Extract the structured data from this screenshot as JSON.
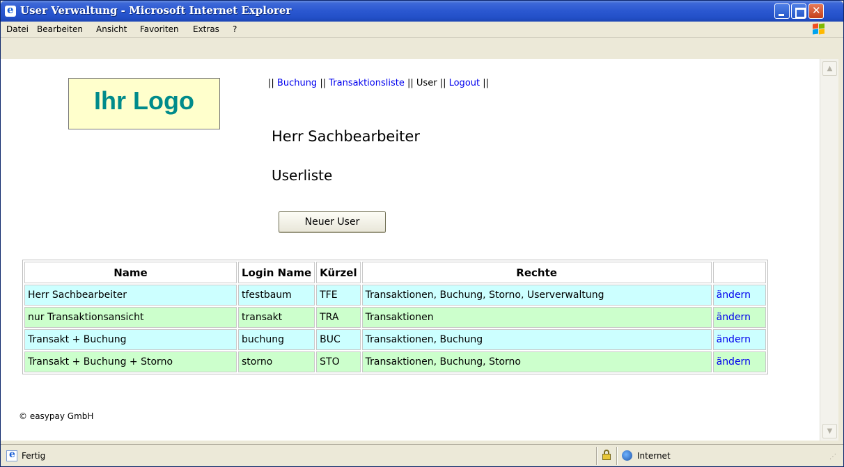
{
  "window": {
    "title": "User Verwaltung - Microsoft Internet Explorer"
  },
  "menubar": {
    "items": [
      "Datei",
      "Bearbeiten",
      "Ansicht",
      "Favoriten",
      "Extras",
      "?"
    ]
  },
  "page": {
    "logo_text": "Ihr Logo",
    "nav": {
      "sep": "||",
      "items": [
        {
          "label": "Buchung",
          "link": true
        },
        {
          "label": "Transaktionsliste",
          "link": true
        },
        {
          "label": "User",
          "link": false
        },
        {
          "label": "Logout",
          "link": true
        }
      ]
    },
    "user_name": "Herr Sachbearbeiter",
    "section_title": "Userliste",
    "new_user_button": "Neuer User",
    "table": {
      "headers": [
        "Name",
        "Login Name",
        "Kürzel",
        "Rechte",
        ""
      ],
      "rows": [
        {
          "name": "Herr Sachbearbeiter",
          "login": "tfestbaum",
          "kuerzel": "TFE",
          "rechte": "Transaktionen, Buchung, Storno, Userverwaltung",
          "action": "ändern",
          "color": "#ccffff"
        },
        {
          "name": "nur Transaktionsansicht",
          "login": "transakt",
          "kuerzel": "TRA",
          "rechte": "Transaktionen",
          "action": "ändern",
          "color": "#ccffcc"
        },
        {
          "name": "Transakt + Buchung",
          "login": "buchung",
          "kuerzel": "BUC",
          "rechte": "Transaktionen, Buchung",
          "action": "ändern",
          "color": "#ccffff"
        },
        {
          "name": "Transakt + Buchung + Storno",
          "login": "storno",
          "kuerzel": "STO",
          "rechte": "Transaktionen, Buchung, Storno",
          "action": "ändern",
          "color": "#ccffcc"
        }
      ]
    },
    "footer": "© easypay GmbH"
  },
  "statusbar": {
    "status": "Fertig",
    "zone": "Internet"
  },
  "colors": {
    "logo_bg": "#ffffcc",
    "logo_text": "#008b8b",
    "link": "#0000ee",
    "row_cyan": "#ccffff",
    "row_green": "#ccffcc"
  }
}
